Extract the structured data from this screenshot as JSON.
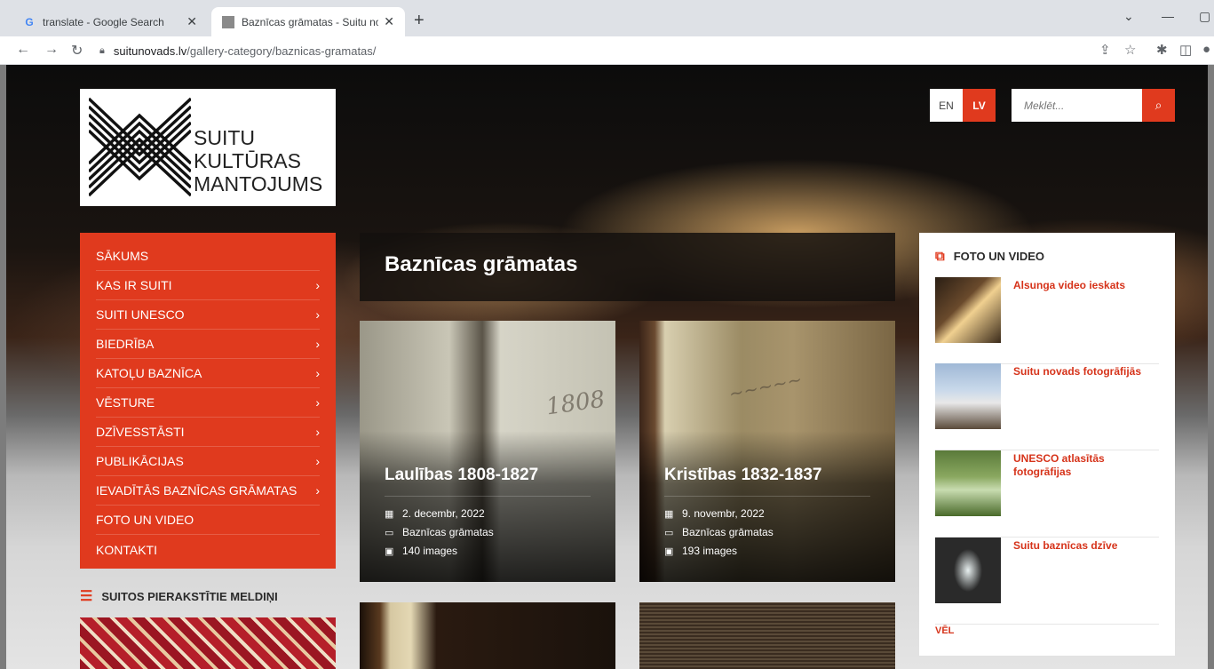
{
  "browser": {
    "tabs": [
      {
        "title": "translate - Google Search",
        "active": false
      },
      {
        "title": "Baznīcas grāmatas - Suitu novad",
        "active": true
      }
    ],
    "url_host": "suitunovads.lv",
    "url_path": "/gallery-category/baznicas-gramatas/"
  },
  "site": {
    "logo_lines": [
      "SUITU",
      "KULTŪRAS",
      "MANTOJUMS"
    ],
    "lang_en": "EN",
    "lang_lv": "LV",
    "search_placeholder": "Meklēt...",
    "menu": [
      {
        "label": "SĀKUMS",
        "has_sub": false
      },
      {
        "label": "KAS IR SUITI",
        "has_sub": true
      },
      {
        "label": "SUITI UNESCO",
        "has_sub": true
      },
      {
        "label": "BIEDRĪBA",
        "has_sub": true
      },
      {
        "label": "KATOĻU BAZNĪCA",
        "has_sub": true
      },
      {
        "label": "VĒSTURE",
        "has_sub": true
      },
      {
        "label": "DZĪVESSTĀSTI",
        "has_sub": true
      },
      {
        "label": "PUBLIKĀCIJAS",
        "has_sub": true
      },
      {
        "label": "IEVADĪTĀS BAZNĪCAS GRĀMATAS",
        "has_sub": true
      },
      {
        "label": "FOTO UN VIDEO",
        "has_sub": false
      },
      {
        "label": "KONTAKTI",
        "has_sub": false
      }
    ],
    "widget_melodies_title": "SUITOS PIERAKSTĪTIE MELDIŅI",
    "page_title": "Baznīcas grāmatas",
    "cards": [
      {
        "title": "Laulības 1808-1827",
        "date": "2. decembr, 2022",
        "category": "Baznīcas grāmatas",
        "images": "140 images"
      },
      {
        "title": "Kristības 1832-1837",
        "date": "9. novembr, 2022",
        "category": "Baznīcas grāmatas",
        "images": "193 images"
      }
    ],
    "sidebar_title": "FOTO UN VIDEO",
    "sidebar_items": [
      "Alsunga video ieskats",
      "Suitu novads fotogrāfijās",
      "UNESCO atlasītās fotogrāfijas",
      "Suitu baznīcas dzīve"
    ],
    "sidebar_more": "VĒL"
  }
}
